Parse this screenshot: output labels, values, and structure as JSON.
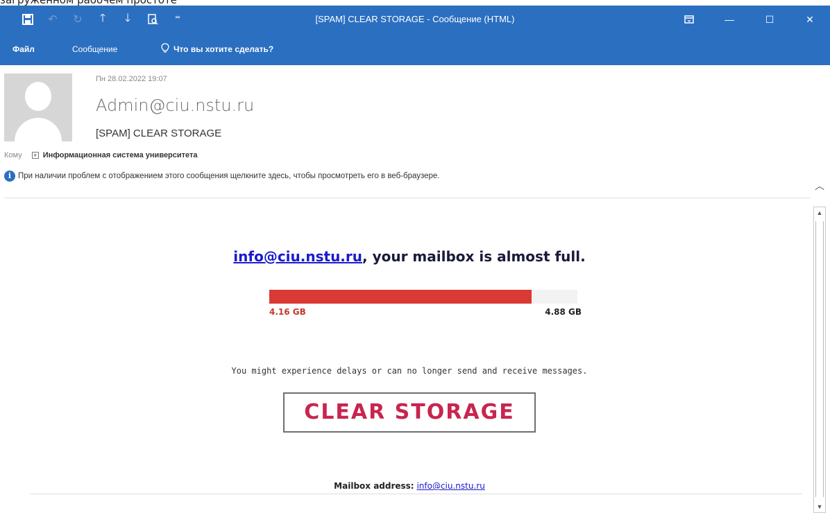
{
  "top_caption": "загруженном рабочем простоте",
  "window": {
    "title": "[SPAM] CLEAR STORAGE - Сообщение (HTML)",
    "qat_icons": [
      "save-icon",
      "undo-icon",
      "redo-icon",
      "up-arrow-icon",
      "down-arrow-icon",
      "preview-icon",
      "customize-icon"
    ],
    "controls": [
      "ribbon-display-icon",
      "minimize-icon",
      "maximize-icon",
      "close-icon"
    ]
  },
  "ribbon": {
    "tabs": [
      "Файл",
      "Сообщение"
    ],
    "tell_me": "Что вы хотите сделать?"
  },
  "message_header": {
    "date": "Пн 28.02.2022 19:07",
    "sender": "Admin@ciu.nstu.ru",
    "subject": "[SPAM] CLEAR STORAGE",
    "to_label": "Кому",
    "to_value": "Информационная система университета",
    "info_bar": "При наличии проблем с отображением этого сообщения щелкните здесь, чтобы просмотреть его в веб-браузере."
  },
  "email_body": {
    "headline_link": "info@ciu.nstu.ru",
    "headline_rest": ", your mailbox is almost full.",
    "storage": {
      "used_label": "4.16 GB",
      "total_label": "4.88 GB",
      "used_fraction": 0.852,
      "fill_color": "#d93a33"
    },
    "warning": "You might experience delays or can no longer send and receive messages.",
    "cta_label": "CLEAR STORAGE",
    "cta_color": "#c8254f",
    "address_label": "Mailbox address:",
    "address_value": "info@ciu.nstu.ru"
  },
  "colors": {
    "ribbon_blue": "#2b6fc1",
    "link_blue": "#1a1acc"
  }
}
